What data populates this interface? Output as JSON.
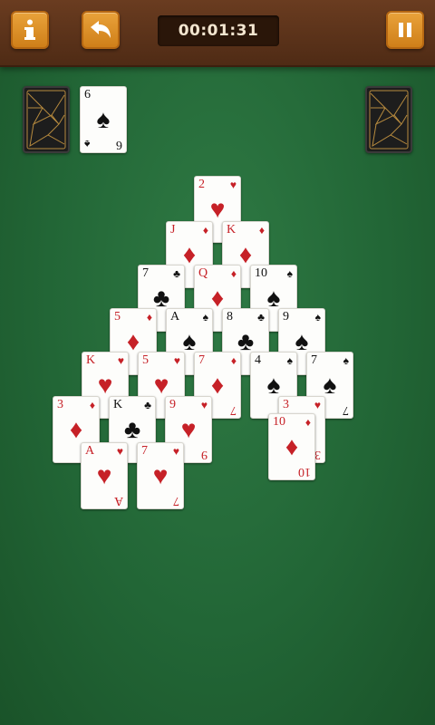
{
  "header": {
    "timer": "00:01:31",
    "info_icon": "info-icon",
    "undo_icon": "undo-arrow-icon",
    "pause_icon": "pause-icon",
    "bar_color": "#5a3219",
    "button_color": "#e39a32"
  },
  "waste_card": {
    "rank": "6",
    "suit": "♠",
    "color": "black"
  },
  "pyramid": [
    {
      "rank": "2",
      "suit": "♥",
      "color": "red"
    },
    {
      "rank": "J",
      "suit": "♦",
      "color": "red"
    },
    {
      "rank": "K",
      "suit": "♦",
      "color": "red"
    },
    {
      "rank": "7",
      "suit": "♣",
      "color": "black"
    },
    {
      "rank": "Q",
      "suit": "♦",
      "color": "red"
    },
    {
      "rank": "10",
      "suit": "♠",
      "color": "black"
    },
    {
      "rank": "5",
      "suit": "♦",
      "color": "red"
    },
    {
      "rank": "A",
      "suit": "♠",
      "color": "black"
    },
    {
      "rank": "8",
      "suit": "♣",
      "color": "black"
    },
    {
      "rank": "9",
      "suit": "♠",
      "color": "black"
    },
    {
      "rank": "K",
      "suit": "♥",
      "color": "red"
    },
    {
      "rank": "5",
      "suit": "♥",
      "color": "red"
    },
    {
      "rank": "7",
      "suit": "♦",
      "color": "red"
    },
    {
      "rank": "4",
      "suit": "♠",
      "color": "black"
    },
    {
      "rank": "7",
      "suit": "♠",
      "color": "black"
    },
    {
      "rank": "3",
      "suit": "♦",
      "color": "red"
    },
    {
      "rank": "K",
      "suit": "♣",
      "color": "black"
    },
    {
      "rank": "9",
      "suit": "♥",
      "color": "red"
    },
    {
      "rank": "3",
      "suit": "♥",
      "color": "red"
    },
    {
      "rank": "A",
      "suit": "♥",
      "color": "red"
    },
    {
      "rank": "7",
      "suit": "♥",
      "color": "red"
    },
    {
      "rank": "10",
      "suit": "♦",
      "color": "red"
    }
  ],
  "stock": {
    "back": "card-back-gold-lines"
  },
  "discard": {
    "back": "card-back-gold-lines"
  }
}
